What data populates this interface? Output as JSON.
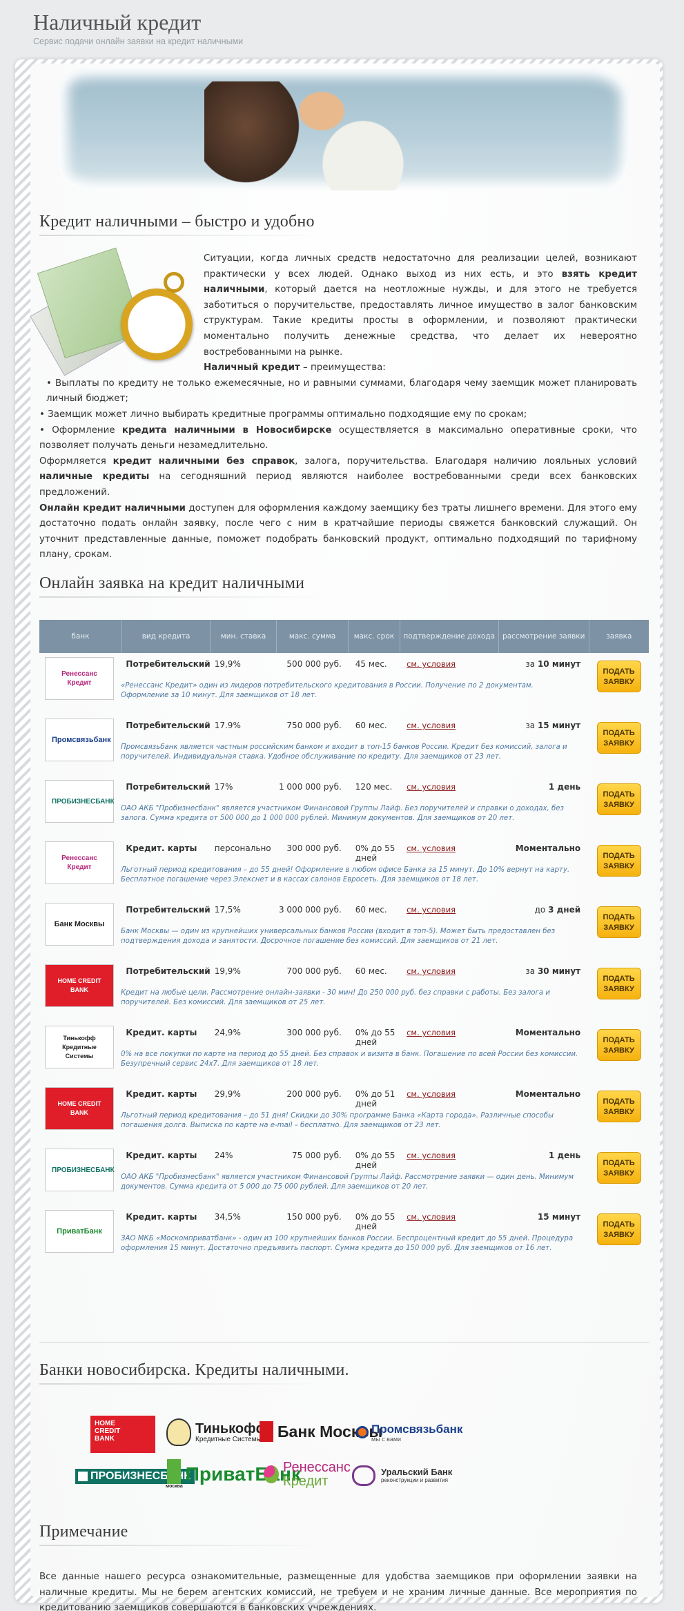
{
  "site": {
    "title": "Наличный кредит",
    "subtitle": "Сервис подачи онлайн заявки на кредит наличными"
  },
  "intro": {
    "heading": "Кредит наличными – быстро и удобно",
    "p1_a": "Ситуации, когда личных средств недостаточно для реализации целей, возникают практически у всех людей. Однако выход из них есть, и это ",
    "p1_bold": "взять кредит наличными",
    "p1_b": ", который дается на неотложные нужды, и для этого не требуется заботиться о поручительстве, предоставлять личное имущество в залог банковским структурам. Такие кредиты просты в оформлении, и позволяют практически моментально получить денежные средства, что делает их невероятно востребованными на рынке.",
    "adv_bold": "Наличный кредит",
    "adv_rest": " – преимущества:",
    "b1": "• Выплаты по кредиту не только ежемесячные, но и равными суммами, благодаря чему заемщик может планировать личный бюджет;",
    "b2": "• Заемщик может лично выбирать кредитные программы оптимально подходящие ему по срокам;",
    "b3_a": "• Оформление ",
    "b3_bold": "кредита наличными в Новосибирске",
    "b3_b": " осуществляется в максимально оперативные сроки, что позволяет получать деньги незамедлительно.",
    "p2_a": "Оформляется ",
    "p2_bold": "кредит наличными без справок",
    "p2_b": ", залога, поручительства. Благодаря наличию лояльных условий ",
    "p2_bold2": "наличные кредиты",
    "p2_c": " на сегодняшний период являются наиболее востребованными среди всех банковских предложений.",
    "p3_bold": "Онлайн кредит наличными",
    "p3_rest": " доступен для оформления каждому заемщику без траты лишнего времени. Для этого ему достаточно подать онлайн заявку, после чего с ним в кратчайшие периоды свяжется банковский служащий. Он уточнит представленные данные, поможет подобрать банковский продукт, оптимально подходящий по тарифному плану, срокам."
  },
  "offers": {
    "heading": "Онлайн заявка на кредит наличными",
    "columns": [
      "банк",
      "вид кредита",
      "мин. ставка",
      "макс. сумма",
      "макс. срок",
      "подтверждение дохода",
      "рассмотрение заявки",
      "заявка"
    ],
    "rows": [
      {
        "bank": "Ренессанс Кредит",
        "kind": "Потребительский",
        "rate": "19,9%",
        "sum": "500 000 руб.",
        "term": "45 мес.",
        "cond": "см. условия",
        "review_pre": "за ",
        "review_bold": "10 минут",
        "button": "ПОДАТЬ ЗАЯВКУ",
        "desc": "«Ренессанс Кредит» один из лидеров потребительского кредитования в России. Получение по 2 документам. Оформление за 10 минут. Для заемщиков от 18 лет."
      },
      {
        "bank": "Промсвязьбанк",
        "kind": "Потребительский",
        "rate": "17.9%",
        "sum": "750 000 руб.",
        "term": "60 мес.",
        "cond": "см. условия",
        "review_pre": "за ",
        "review_bold": "15 минут",
        "button": "ПОДАТЬ ЗАЯВКУ",
        "desc": "Промсвязьбанк является частным российским банком и входит в топ-15 банков России. Кредит без комиссий, залога и поручителей. Индивидуальная ставка. Удобное обслуживание по кредиту. Для заемщиков от 23 лет."
      },
      {
        "bank": "ПРОБИЗНЕСБАНК",
        "kind": "Потребительский",
        "rate": "17%",
        "sum": "1 000 000 руб.",
        "term": "120 мес.",
        "cond": "см. условия",
        "review_pre": "",
        "review_bold": "1 день",
        "button": "ПОДАТЬ ЗАЯВКУ",
        "desc": "ОАО АКБ \"Пробизнесбанк\" является участником Финансовой Группы Лайф. Без поручителей и справки о доходах, без залога. Сумма кредита от 500 000 до 1 000 000 рублей. Минимум документов. Для заемщиков от 20 лет."
      },
      {
        "bank": "Ренессанс Кредит",
        "kind": "Кредит. карты",
        "rate": "персонально",
        "sum": "300 000 руб.",
        "term": "0% до 55 дней",
        "cond": "см. условия",
        "review_pre": "",
        "review_bold": "Моментально",
        "button": "ПОДАТЬ ЗАЯВКУ",
        "desc": "Льготный период кредитования – до 55 дней! Оформление в любом офисе Банка за 15 минут. До 10% вернут на карту. Бесплатное погашение через Элекснет и в кассах салонов Евросеть. Для заемщиков от 18 лет."
      },
      {
        "bank": "Банк Москвы",
        "kind": "Потребительский",
        "rate": "17,5%",
        "sum": "3 000  000 руб.",
        "term": "60 мес.",
        "cond": "см. условия",
        "review_pre": "до ",
        "review_bold": "3 дней",
        "button": "ПОДАТЬ ЗАЯВКУ",
        "desc": "Банк Москвы — один из крупнейших универсальных банков России (входит в топ-5). Может быть предоставлен без подтверждения дохода и занятости. Досрочное погашение без комиссий. Для заемщиков от 21 лет."
      },
      {
        "bank": "HOME CREDIT BANK",
        "kind": "Потребительский",
        "rate": "19,9%",
        "sum": "700 000 руб.",
        "term": "60 мес.",
        "cond": "см. условия",
        "review_pre": "за ",
        "review_bold": "30 минут",
        "button": "ПОДАТЬ ЗАЯВКУ",
        "desc": "Кредит на любые цели. Рассмотрение онлайн-заявки - 30 мин! До 250 000 руб. без справки с работы. Без залога и поручителей. Без комиссий. Для заемщиков от 25 лет."
      },
      {
        "bank": "Тинькофф Кредитные Системы",
        "kind": "Кредит. карты",
        "rate": "24,9%",
        "sum": "300 000 руб.",
        "term": "0% до 55 дней",
        "cond": "см. условия",
        "review_pre": "",
        "review_bold": "Моментально",
        "button": "ПОДАТЬ ЗАЯВКУ",
        "desc": "0% на все покупки по карте на период до 55 дней. Без справок и визита в банк. Погашение по всей России без комиссии. Безупречный сервис 24х7. Для заемщиков от 18 лет."
      },
      {
        "bank": "HOME CREDIT BANK",
        "kind": "Кредит. карты",
        "rate": "29,9%",
        "sum": "200 000 руб.",
        "term": "0% до 51 дней",
        "cond": "см. условия",
        "review_pre": "",
        "review_bold": "Моментально",
        "button": "ПОДАТЬ ЗАЯВКУ",
        "desc": "Льготный период кредитования – до 51 дня! Скидки до 30% программе Банка «Карта города». Различные способы погашения долга. Выписка по карте на e-mail – бесплатно. Для заемщиков от 23 лет."
      },
      {
        "bank": "ПРОБИЗНЕСБАНК",
        "kind": "Кредит. карты",
        "rate": "24%",
        "sum": "75 000 руб.",
        "term": "0% до 55 дней",
        "cond": "см. условия",
        "review_pre": "",
        "review_bold": "1 день",
        "button": "ПОДАТЬ ЗАЯВКУ",
        "desc": "ОАО АКБ \"Пробизнесбанк\" является участником Финансовой Группы Лайф. Рассмотрение заявки — один день. Минимум документов. Сумма кредита от 5 000 до 75 000 рублей. Для заемщиков от 20 лет."
      },
      {
        "bank": "ПриватБанк",
        "kind": "Кредит. карты",
        "rate": "34,5%",
        "sum": "150 000 руб.",
        "term": "0% до 55 дней",
        "cond": "см. условия",
        "review_pre": "",
        "review_bold": "15 минут",
        "button": "ПОДАТЬ ЗАЯВКУ",
        "desc": "ЗАО МКБ «Москомприватбанк» - один из 100 крупнейших банков России. Беспроцентный кредит до 55 дней. Процедура оформления 15 минут. Достаточно предъявить паспорт. Сумма кредита до 150 000 руб. Для заемщиков от 16 лет."
      }
    ]
  },
  "banks": {
    "heading": "Банки новосибирска. Кредиты наличными.",
    "homecredit": "HOME CREDIT BANK",
    "tinkoff": "Тинькофф",
    "tinkoff_sub": "Кредитные Системы",
    "moscow": "Банк Москвы",
    "psb": "Промсвязьбанк",
    "psb_sub": "мы с вами",
    "probiz": "ПРОБИЗНЕСБАНК",
    "privat": "ПриватБанк",
    "privat_sub": "москва",
    "renaissance": "Ренессанс",
    "renaissance_sub": "Кредит",
    "ural": "Уральский Банк",
    "ural_sub": "реконструкции и развития"
  },
  "note": {
    "heading": "Примечание",
    "text": "Все данные нашего ресурса ознакомительные, размещенные для удобства заемщиков при оформлении заявки на наличные кредиты. Мы не берем агентских комиссий, не требуем и не храним личные данные. Все мероприятия по кредитованию заемщиков совершаются в банковских учреждениях."
  },
  "colors": {
    "header_row": "#7d93a5",
    "button": "#f6b20f",
    "link": "#8b1c1c",
    "desc": "#4e79a1"
  }
}
